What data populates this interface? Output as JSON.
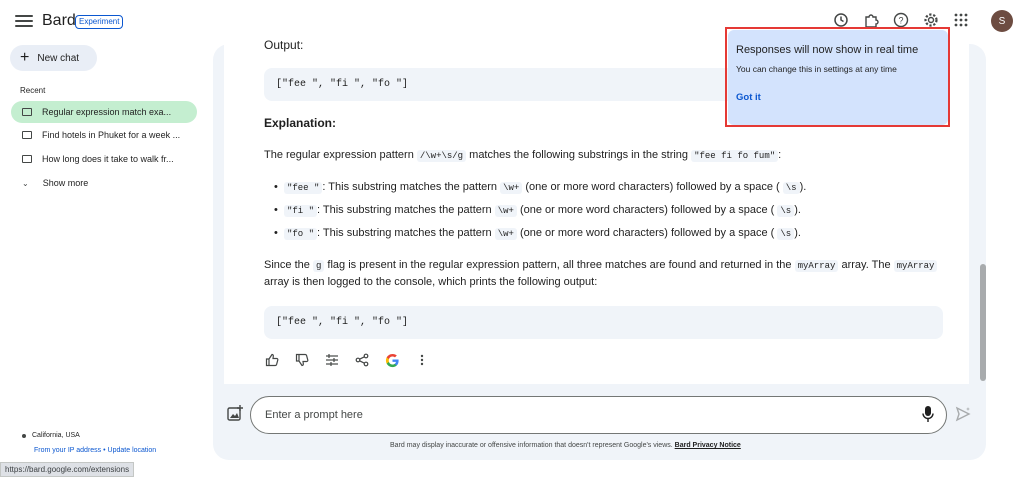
{
  "app": {
    "name": "Bard",
    "badge": "Experiment"
  },
  "sidebar": {
    "new_chat_label": "New chat",
    "recent_label": "Recent",
    "items": [
      {
        "label": "Regular expression match exa...",
        "active": true
      },
      {
        "label": "Find hotels in Phuket for a week ...",
        "active": false
      },
      {
        "label": "How long does it take to walk fr...",
        "active": false
      }
    ],
    "show_more_label": "Show more",
    "location": "California, USA",
    "location_source": "From your IP address",
    "update_location": "Update location",
    "separator": "•"
  },
  "status_url": "https://bard.google.com/extensions",
  "user": {
    "avatar_initial": "S"
  },
  "response": {
    "output_label": "Output:",
    "code1": "[\"fee \", \"fi \", \"fo \"]",
    "explanation_heading": "Explanation:",
    "para1_a": "The regular expression pattern",
    "para1_code1": "/\\w+\\s/g",
    "para1_b": "matches the following substrings in the string",
    "para1_code2": "\"fee fi fo fum\"",
    "para1_c": ":",
    "bullets": [
      {
        "code": "\"fee \"",
        "a": ": This substring matches the pattern",
        "code2": "\\w+",
        "b": "(one or more word characters) followed by a space (",
        "code3": "\\s",
        "c": ")."
      },
      {
        "code": "\"fi \"",
        "a": ": This substring matches the pattern",
        "code2": "\\w+",
        "b": "(one or more word characters) followed by a space (",
        "code3": "\\s",
        "c": ")."
      },
      {
        "code": "\"fo \"",
        "a": ": This substring matches the pattern",
        "code2": "\\w+",
        "b": "(one or more word characters) followed by a space (",
        "code3": "\\s",
        "c": ")."
      }
    ],
    "para2_a": "Since the",
    "para2_code1": "g",
    "para2_b": "flag is present in the regular expression pattern, all three matches are found and returned in the",
    "para2_code2": "myArray",
    "para2_c": "array. The",
    "para2_code3": "myArray",
    "para2_line2": "array is then logged to the console, which prints the following output:",
    "code2": "[\"fee \", \"fi \", \"fo \"]"
  },
  "prompt": {
    "placeholder": "Enter a prompt here"
  },
  "disclaimer": {
    "text": "Bard may display inaccurate or offensive information that doesn't represent Google's views.",
    "link": "Bard Privacy Notice"
  },
  "popup": {
    "title": "Responses will now show in real time",
    "subtitle": "You can change this in settings at any time",
    "button": "Got it"
  },
  "colors": {
    "accent": "#0b57d0",
    "active_item_bg": "#c4eed0",
    "popup_bg": "#d3e3fd",
    "highlight_outline": "#e53935"
  },
  "icons": {
    "menu": "hamburger-menu-icon",
    "history": "history-icon",
    "extensions": "puzzle-icon",
    "help": "help-icon",
    "settings": "gear-icon",
    "apps": "apps-grid-icon"
  }
}
